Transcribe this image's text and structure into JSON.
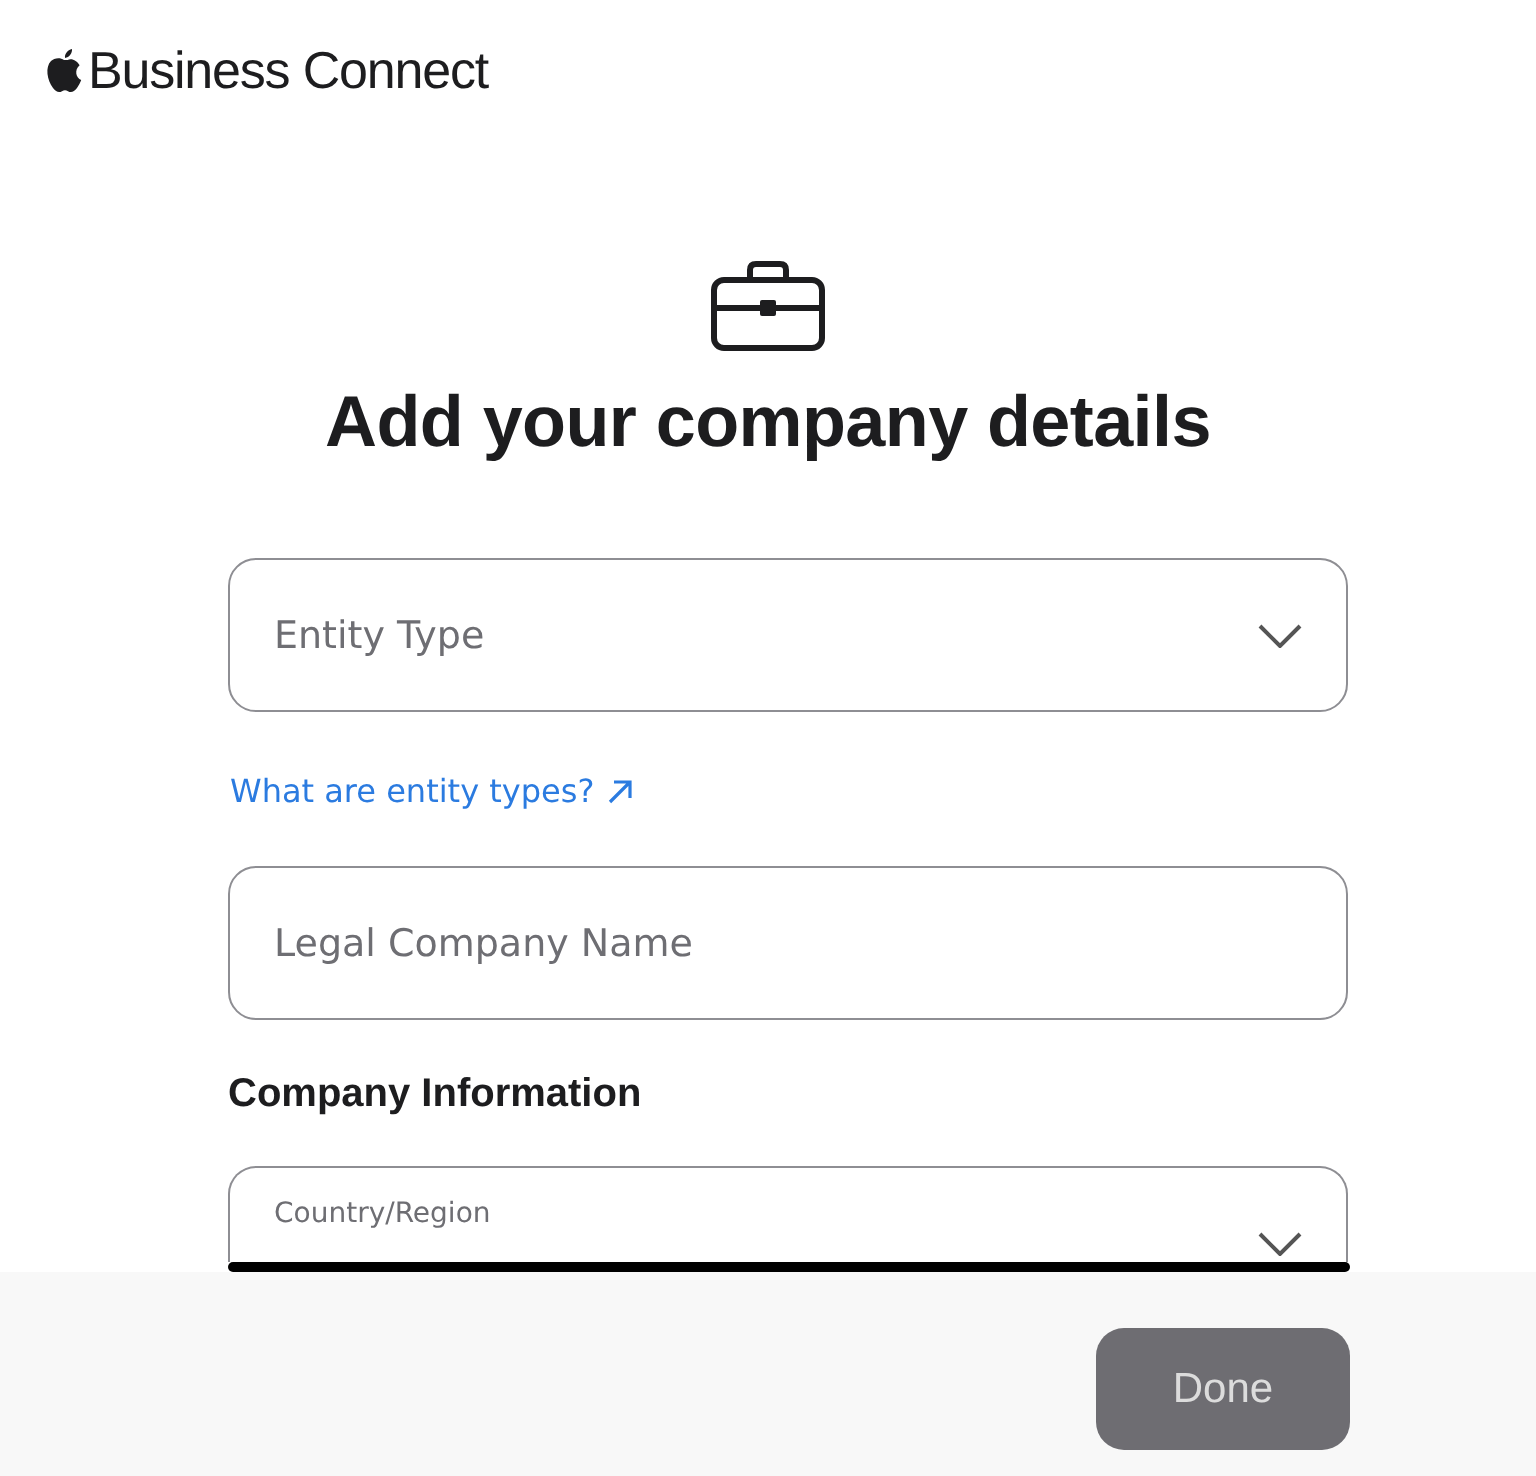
{
  "header": {
    "brand": "Business Connect"
  },
  "title": "Add your company details",
  "fields": [
    {
      "kind": "select",
      "placeholder": "Entity Type"
    },
    {
      "kind": "link",
      "label": "What are entity types?"
    },
    {
      "kind": "text",
      "placeholder": "Legal Company Name"
    },
    {
      "kind": "heading",
      "label": "Company Information"
    },
    {
      "kind": "select",
      "label": "Country/Region"
    }
  ],
  "footer": {
    "button": {
      "label": "Done",
      "disabled": true
    }
  }
}
